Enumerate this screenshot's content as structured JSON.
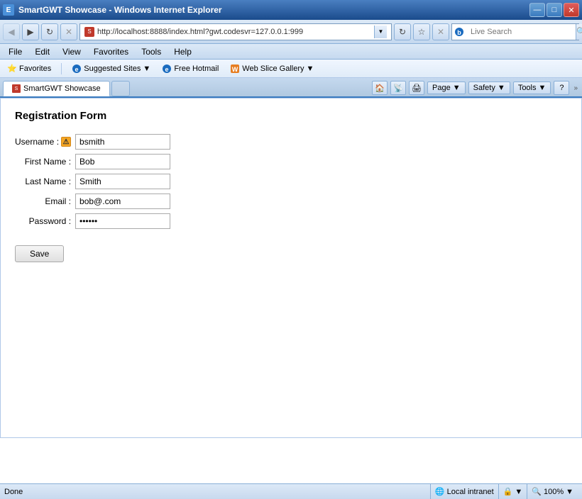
{
  "window": {
    "title": "SmartGWT Showcase - Windows Internet Explorer",
    "favicon": "S"
  },
  "titlebar": {
    "minimize_label": "—",
    "maximize_label": "□",
    "close_label": "✕"
  },
  "navbar": {
    "back_label": "◀",
    "forward_label": "▶",
    "refresh_label": "↻",
    "stop_label": "✕",
    "address_url": "http://localhost:8888/index.html?gwt.codesvr=127.0.0.1:999",
    "address_dropdown": "▼",
    "go_label": "→",
    "refresh2_label": "↻",
    "stop2_label": "✕",
    "search_placeholder": "Live Search",
    "search_btn_label": "🔍"
  },
  "menubar": {
    "items": [
      "File",
      "Edit",
      "View",
      "Favorites",
      "Tools",
      "Help"
    ]
  },
  "favoritesbar": {
    "favorites_label": "Favorites",
    "suggested_label": "Suggested Sites ▼",
    "hotmail_label": "Free Hotmail",
    "webslice_label": "Web Slice Gallery ▼"
  },
  "tabbar": {
    "tab_label": "SmartGWT Showcase",
    "page_label": "Page ▼",
    "safety_label": "Safety ▼",
    "tools_label": "Tools ▼",
    "help_label": "?"
  },
  "form": {
    "title": "Registration Form",
    "username_label": "Username :",
    "username_value": "bsmith",
    "firstname_label": "First Name :",
    "firstname_value": "Bob",
    "lastname_label": "Last Name :",
    "lastname_value": "Smith",
    "email_label": "Email :",
    "email_value": "bob@.com",
    "password_label": "Password :",
    "password_value": "••••••",
    "save_label": "Save"
  },
  "statusbar": {
    "status_text": "Done",
    "intranet_label": "Local intranet",
    "security_icon": "🔒",
    "zoom_label": "100%",
    "zoom_dropdown": "▼"
  }
}
